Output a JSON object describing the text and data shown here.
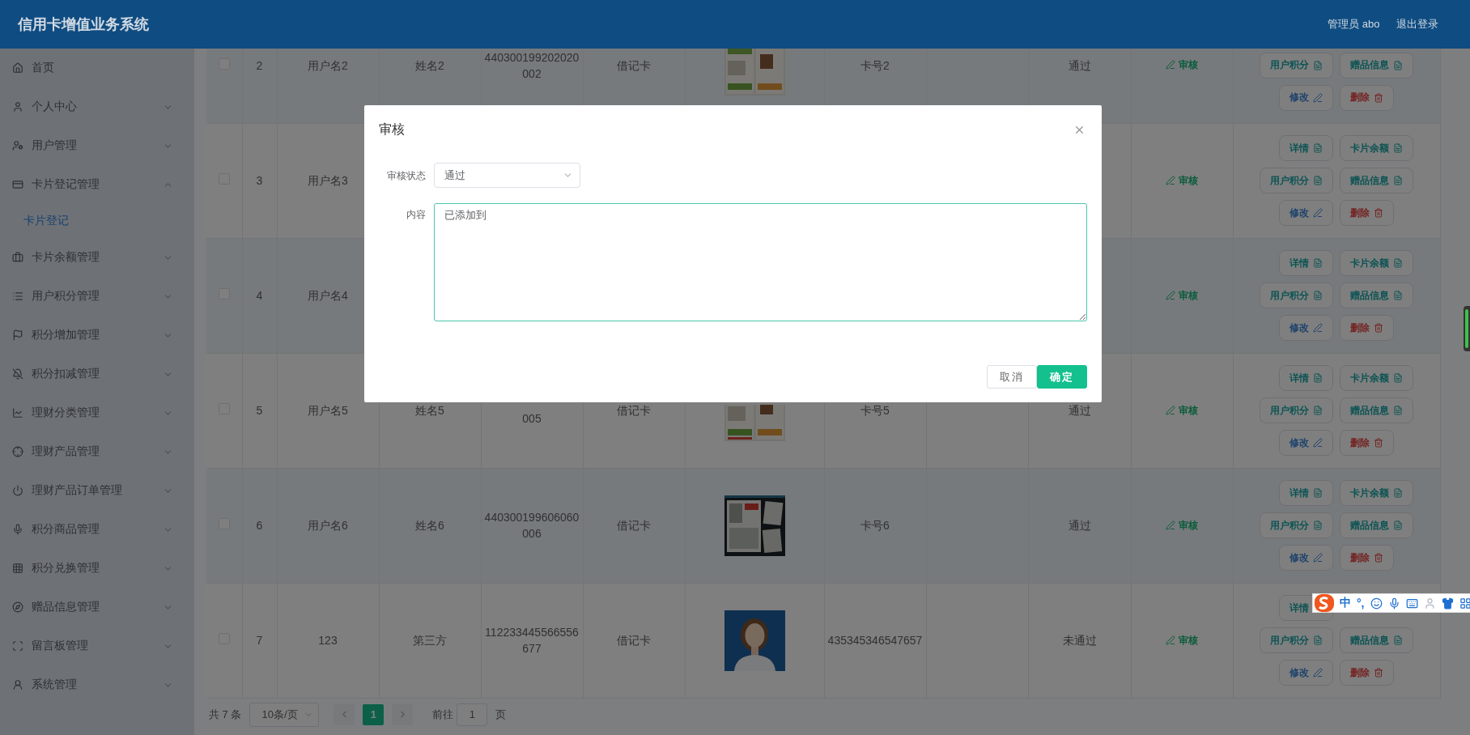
{
  "header": {
    "title": "信用卡增值业务系统",
    "user": "管理员 abo",
    "logout": "退出登录"
  },
  "sidebar": {
    "items": [
      {
        "label": "首页",
        "kind": "link"
      },
      {
        "label": "个人中心",
        "kind": "menu",
        "expanded": false
      },
      {
        "label": "用户管理",
        "kind": "menu",
        "expanded": false
      },
      {
        "label": "卡片登记管理",
        "kind": "menu",
        "expanded": true,
        "children": [
          {
            "label": "卡片登记",
            "selected": true
          }
        ]
      },
      {
        "label": "卡片余额管理",
        "kind": "menu",
        "expanded": false
      },
      {
        "label": "用户积分管理",
        "kind": "menu",
        "expanded": false
      },
      {
        "label": "积分增加管理",
        "kind": "menu",
        "expanded": false
      },
      {
        "label": "积分扣减管理",
        "kind": "menu",
        "expanded": false
      },
      {
        "label": "理财分类管理",
        "kind": "menu",
        "expanded": false
      },
      {
        "label": "理财产品管理",
        "kind": "menu",
        "expanded": false
      },
      {
        "label": "理财产品订单管理",
        "kind": "menu",
        "expanded": false
      },
      {
        "label": "积分商品管理",
        "kind": "menu",
        "expanded": false
      },
      {
        "label": "积分兑换管理",
        "kind": "menu",
        "expanded": false
      },
      {
        "label": "赠品信息管理",
        "kind": "menu",
        "expanded": false
      },
      {
        "label": "留言板管理",
        "kind": "menu",
        "expanded": false
      },
      {
        "label": "系统管理",
        "kind": "menu",
        "expanded": false
      }
    ]
  },
  "table": {
    "rows": [
      {
        "checked": false,
        "index": "2",
        "username": "用户名2",
        "name": "姓名2",
        "id_number": "440300199202020002",
        "card_type": "借记卡",
        "image": {
          "kind": "picture"
        },
        "card_no": "卡号2",
        "status": "通过",
        "review": "审核",
        "actions": [
          {
            "label": "用户积分",
            "kind": "points"
          },
          {
            "label": "赠品信息",
            "kind": "gift"
          },
          {
            "label": "修改",
            "kind": "edit"
          },
          {
            "label": "删除",
            "kind": "delete"
          }
        ]
      },
      {
        "checked": false,
        "index": "3",
        "username": "用户名3",
        "review": "审核",
        "actions": [
          {
            "label": "详情",
            "kind": "detail"
          },
          {
            "label": "卡片余额",
            "kind": "balance"
          },
          {
            "label": "用户积分",
            "kind": "points"
          },
          {
            "label": "赠品信息",
            "kind": "gift"
          },
          {
            "label": "修改",
            "kind": "edit"
          },
          {
            "label": "删除",
            "kind": "delete"
          }
        ]
      },
      {
        "checked": false,
        "index": "4",
        "username": "用户名4",
        "review": "审核",
        "actions": [
          {
            "label": "详情",
            "kind": "detail"
          },
          {
            "label": "卡片余额",
            "kind": "balance"
          },
          {
            "label": "用户积分",
            "kind": "points"
          },
          {
            "label": "赠品信息",
            "kind": "gift"
          },
          {
            "label": "修改",
            "kind": "edit"
          },
          {
            "label": "删除",
            "kind": "delete"
          }
        ]
      },
      {
        "checked": false,
        "index": "5",
        "username": "用户名5",
        "name": "姓名5",
        "id_number": "005",
        "card_type": "借记卡",
        "image": {
          "kind": "picture"
        },
        "card_no": "卡号5",
        "status": "通过",
        "review": "审核",
        "actions": [
          {
            "label": "详情",
            "kind": "detail"
          },
          {
            "label": "卡片余额",
            "kind": "balance"
          },
          {
            "label": "用户积分",
            "kind": "points"
          },
          {
            "label": "赠品信息",
            "kind": "gift"
          },
          {
            "label": "修改",
            "kind": "edit"
          },
          {
            "label": "删除",
            "kind": "delete"
          }
        ]
      },
      {
        "checked": false,
        "index": "6",
        "username": "用户名6",
        "name": "姓名6",
        "id_number": "440300199606060006",
        "card_type": "借记卡",
        "image": {
          "kind": "picture"
        },
        "card_no": "卡号6",
        "status": "通过",
        "review": "审核",
        "actions": [
          {
            "label": "详情",
            "kind": "detail"
          },
          {
            "label": "卡片余额",
            "kind": "balance"
          },
          {
            "label": "用户积分",
            "kind": "points"
          },
          {
            "label": "赠品信息",
            "kind": "gift"
          },
          {
            "label": "修改",
            "kind": "edit"
          },
          {
            "label": "删除",
            "kind": "delete"
          }
        ]
      },
      {
        "checked": false,
        "index": "7",
        "username": "123",
        "name": "第三方",
        "id_number": "112233445566556677",
        "card_type": "借记卡",
        "image": {
          "kind": "picture"
        },
        "card_no": "435345346547657",
        "status": "未通过",
        "review": "审核",
        "actions": [
          {
            "label": "详情",
            "kind": "detail"
          },
          {
            "label": "用户积分",
            "kind": "points"
          },
          {
            "label": "赠品信息",
            "kind": "gift"
          },
          {
            "label": "修改",
            "kind": "edit"
          },
          {
            "label": "删除",
            "kind": "delete"
          }
        ]
      }
    ]
  },
  "pagination": {
    "total": "共 7 条",
    "page_size": "10条/页",
    "pages": [
      {
        "label": "1",
        "selected": true
      }
    ],
    "goto_label": "前往",
    "goto_value": "1",
    "goto_suffix": "页"
  },
  "dialog": {
    "title": "审核",
    "fields": [
      {
        "kind": "select",
        "label": "审核状态",
        "value": "通过"
      },
      {
        "kind": "textarea",
        "label": "内容",
        "value": "已添加到"
      }
    ],
    "buttons": [
      {
        "label": "取消",
        "kind": "secondary"
      },
      {
        "label": "确定",
        "kind": "primary"
      }
    ]
  },
  "ime_toolbar": {
    "mode": "中",
    "punct": "°,"
  }
}
